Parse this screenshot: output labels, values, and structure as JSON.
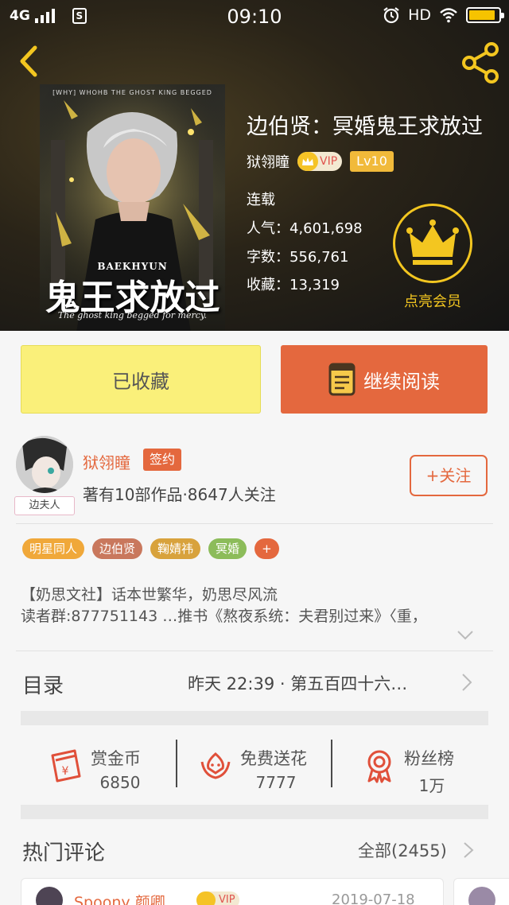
{
  "status_bar": {
    "network": "4G",
    "sim_icon": "S",
    "time": "09:10",
    "hd": "HD",
    "battery_level": 0.9
  },
  "header": {
    "back_icon": "chevron-left-icon",
    "share_icon": "share-icon"
  },
  "book": {
    "cover_header": "[WHY] WHOHB THE GHOST KING BEGGED",
    "cover_english_name": "BAEKHYUN",
    "cover_title": "鬼王求放过",
    "cover_subtitle": "The ghost king begged for mercy.",
    "title": "边伯贤：冥婚鬼王求放过",
    "author": "狱翎瞳",
    "vip_label": "VIP",
    "level": "Lv10",
    "status": "连载",
    "popularity_label": "人气：",
    "popularity": "4,601,698",
    "word_count_label": "字数：",
    "word_count": "556,761",
    "favorites_label": "收藏：",
    "favorites": "13,319",
    "member_label": "点亮会员"
  },
  "actions": {
    "collected_label": "已收藏",
    "continue_reading_label": "继续阅读"
  },
  "author_info": {
    "name": "狱翎瞳",
    "signed_badge": "签约",
    "avatar_tag": "边夫人",
    "meta": "著有10部作品·8647人关注",
    "follow_label": "+关注"
  },
  "tags": [
    {
      "label": "明星同人",
      "color": "#f0a83a"
    },
    {
      "label": "边伯贤",
      "color": "#c9785d"
    },
    {
      "label": "鞠婧祎",
      "color": "#d8a23c"
    },
    {
      "label": "冥婚",
      "color": "#8cbc5a"
    },
    {
      "label": "+",
      "color": "#e4683e"
    }
  ],
  "intro": {
    "line1": "【奶思文社】话本世繁华，奶思尽风流",
    "line2": "读者群:877751143 …推书《熬夜系统：夫君别过来》〈重，"
  },
  "toc": {
    "label": "目录",
    "update": "昨天 22:39 · 第五百四十六…"
  },
  "stats": [
    {
      "title": "赏金币",
      "value": "6850",
      "icon": "red-envelope-icon"
    },
    {
      "title": "免费送花",
      "value": "7777",
      "icon": "flower-icon"
    },
    {
      "title": "粉丝榜",
      "value": "1万",
      "icon": "medal-icon"
    }
  ],
  "comments": {
    "label": "热门评论",
    "all_label": "全部(2455)",
    "first": {
      "name": "Spoony   颜卿",
      "vip": "VIP",
      "date": "2019-07-18"
    }
  }
}
